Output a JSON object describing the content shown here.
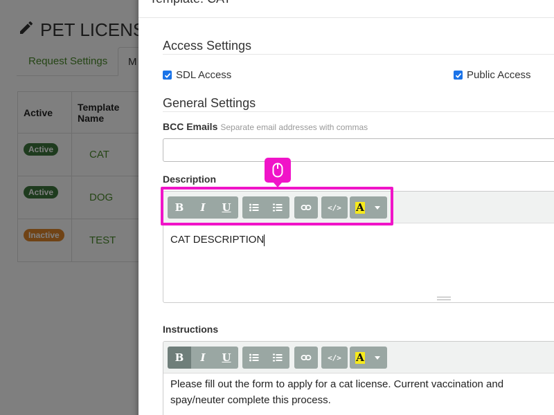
{
  "page": {
    "title": "PET LICENSE",
    "tabs": [
      "Request Settings",
      "M"
    ],
    "table": {
      "headers": [
        "Active",
        "Template Name"
      ],
      "rows": [
        {
          "status": "Active",
          "name": "CAT"
        },
        {
          "status": "Active",
          "name": "DOG"
        },
        {
          "status": "Inactive",
          "name": "TEST"
        }
      ]
    }
  },
  "modal": {
    "title": "Template: CAT",
    "access_settings": {
      "heading": "Access Settings",
      "sdl_access": {
        "label": "SDL Access",
        "checked": true
      },
      "public_access": {
        "label": "Public Access",
        "checked": true
      }
    },
    "general_settings": {
      "heading": "General Settings",
      "bcc": {
        "label": "BCC Emails",
        "hint": "Separate email addresses with commas",
        "value": "",
        "placeholder": ""
      },
      "description": {
        "label": "Description",
        "content": "CAT DESCRIPTION"
      },
      "instructions": {
        "label": "Instructions",
        "content": "Please fill out the form to apply for a cat license. Current vaccination and spay/neuter complete this process."
      }
    },
    "toolbar": {
      "buttons": [
        "bold",
        "italic",
        "underline",
        "bullet-list",
        "numbered-list",
        "link",
        "code",
        "highlight"
      ],
      "bold_glyph": "B",
      "italic_glyph": "I",
      "underline_glyph": "U",
      "code_glyph": "</>",
      "highlight_glyph": "A"
    }
  },
  "colors": {
    "accent": "#1a73e8",
    "annotation": "#f014c8",
    "toolbar_button": "#9aa7a3",
    "badge_active": "#3c763d",
    "badge_inactive": "#e0862a",
    "link_green": "#4a8a2a"
  }
}
